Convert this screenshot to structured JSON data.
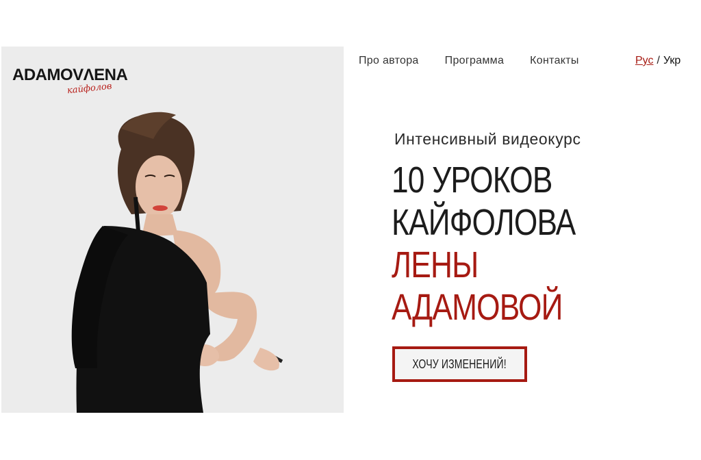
{
  "brand": {
    "wordmark": "ADAMOVΛENA",
    "script": "кайфолов"
  },
  "nav": {
    "items": [
      "Про автора",
      "Программа",
      "Контакты"
    ]
  },
  "language": {
    "active": "Рус",
    "separator": "/",
    "inactive": "Укр"
  },
  "hero": {
    "subtitle": "Интенсивный видеокурс",
    "headline_lines": [
      "10 УРОКОВ",
      "КАЙФОЛОВА",
      "ЛЕНЫ",
      "АДАМОВОЙ"
    ],
    "cta_label": "ХОЧУ ИЗМЕНЕНИЙ!"
  },
  "colors": {
    "accent": "#a61a12",
    "panel_bg": "#ececec",
    "text": "#1c1c1c"
  }
}
